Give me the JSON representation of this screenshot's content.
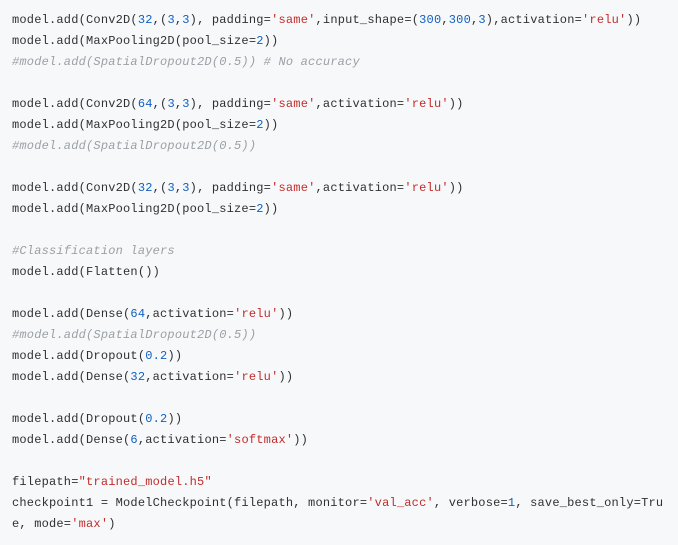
{
  "code": {
    "tokens": [
      [
        [
          "k",
          "model.add(Conv2D("
        ],
        [
          "n",
          "32"
        ],
        [
          "k",
          ",("
        ],
        [
          "n",
          "3"
        ],
        [
          "k",
          ","
        ],
        [
          "n",
          "3"
        ],
        [
          "k",
          "), padding="
        ],
        [
          "s",
          "'same'"
        ],
        [
          "k",
          ",input_shape=("
        ],
        [
          "n",
          "300"
        ],
        [
          "k",
          ","
        ],
        [
          "n",
          "300"
        ],
        [
          "k",
          ","
        ],
        [
          "n",
          "3"
        ],
        [
          "k",
          "),activation="
        ],
        [
          "s",
          "'relu'"
        ],
        [
          "k",
          "))"
        ]
      ],
      [
        [
          "k",
          "model.add(MaxPooling2D(pool_size="
        ],
        [
          "n",
          "2"
        ],
        [
          "k",
          "))"
        ]
      ],
      [
        [
          "c",
          "#model.add(SpatialDropout2D(0.5)) # No accuracy"
        ]
      ],
      [],
      [
        [
          "k",
          "model.add(Conv2D("
        ],
        [
          "n",
          "64"
        ],
        [
          "k",
          ",("
        ],
        [
          "n",
          "3"
        ],
        [
          "k",
          ","
        ],
        [
          "n",
          "3"
        ],
        [
          "k",
          "), padding="
        ],
        [
          "s",
          "'same'"
        ],
        [
          "k",
          ",activation="
        ],
        [
          "s",
          "'relu'"
        ],
        [
          "k",
          "))"
        ]
      ],
      [
        [
          "k",
          "model.add(MaxPooling2D(pool_size="
        ],
        [
          "n",
          "2"
        ],
        [
          "k",
          "))"
        ]
      ],
      [
        [
          "c",
          "#model.add(SpatialDropout2D(0.5))"
        ]
      ],
      [],
      [
        [
          "k",
          "model.add(Conv2D("
        ],
        [
          "n",
          "32"
        ],
        [
          "k",
          ",("
        ],
        [
          "n",
          "3"
        ],
        [
          "k",
          ","
        ],
        [
          "n",
          "3"
        ],
        [
          "k",
          "), padding="
        ],
        [
          "s",
          "'same'"
        ],
        [
          "k",
          ",activation="
        ],
        [
          "s",
          "'relu'"
        ],
        [
          "k",
          "))"
        ]
      ],
      [
        [
          "k",
          "model.add(MaxPooling2D(pool_size="
        ],
        [
          "n",
          "2"
        ],
        [
          "k",
          "))"
        ]
      ],
      [],
      [
        [
          "c",
          "#Classification layers"
        ]
      ],
      [
        [
          "k",
          "model.add(Flatten())"
        ]
      ],
      [],
      [
        [
          "k",
          "model.add(Dense("
        ],
        [
          "n",
          "64"
        ],
        [
          "k",
          ",activation="
        ],
        [
          "s",
          "'relu'"
        ],
        [
          "k",
          "))"
        ]
      ],
      [
        [
          "c",
          "#model.add(SpatialDropout2D(0.5))"
        ]
      ],
      [
        [
          "k",
          "model.add(Dropout("
        ],
        [
          "n",
          "0.2"
        ],
        [
          "k",
          "))"
        ]
      ],
      [
        [
          "k",
          "model.add(Dense("
        ],
        [
          "n",
          "32"
        ],
        [
          "k",
          ",activation="
        ],
        [
          "s",
          "'relu'"
        ],
        [
          "k",
          "))"
        ]
      ],
      [],
      [
        [
          "k",
          "model.add(Dropout("
        ],
        [
          "n",
          "0.2"
        ],
        [
          "k",
          "))"
        ]
      ],
      [
        [
          "k",
          "model.add(Dense("
        ],
        [
          "n",
          "6"
        ],
        [
          "k",
          ",activation="
        ],
        [
          "s",
          "'softmax'"
        ],
        [
          "k",
          "))"
        ]
      ],
      [],
      [
        [
          "k",
          "filepath="
        ],
        [
          "s",
          "\"trained_model.h5\""
        ]
      ],
      [
        [
          "k",
          "checkpoint1 = ModelCheckpoint(filepath, monitor="
        ],
        [
          "s",
          "'val_acc'"
        ],
        [
          "k",
          ", verbose="
        ],
        [
          "n",
          "1"
        ],
        [
          "k",
          ", save_best_only=True, mode="
        ],
        [
          "s",
          "'max'"
        ],
        [
          "k",
          ")"
        ]
      ]
    ]
  }
}
